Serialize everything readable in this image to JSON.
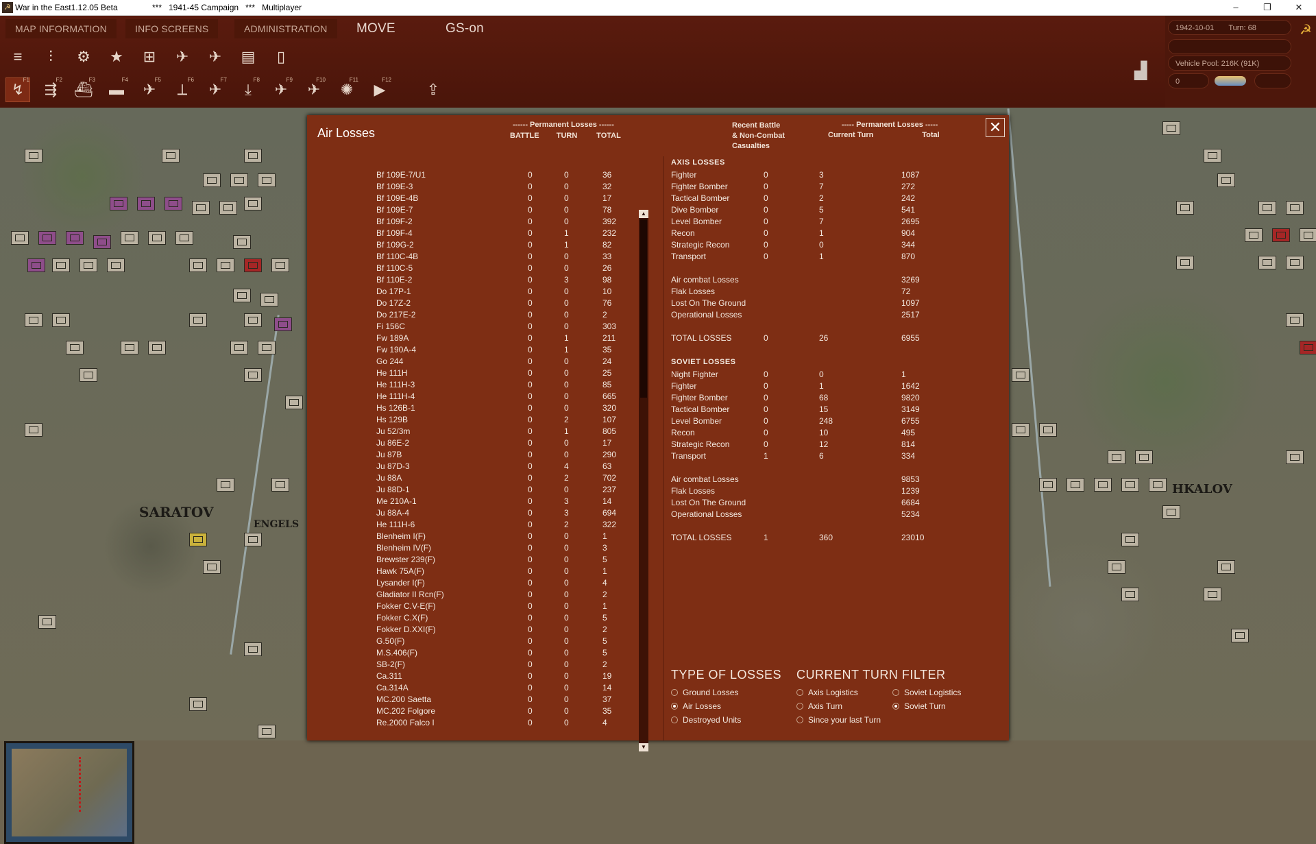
{
  "window": {
    "app_title": "War in the East1.12.05 Beta",
    "campaign": "***   1941-45 Campaign   ***   Multiplayer",
    "minimize": "–",
    "restore": "❐",
    "close": "✕"
  },
  "menu": {
    "tabs": [
      "MAP INFORMATION",
      "INFO SCREENS",
      "ADMINISTRATION",
      "MOVE",
      "GS-on"
    ]
  },
  "status": {
    "date": "1942-10-01",
    "turn": "Turn: 68",
    "vehicle_pool": "Vehicle Pool: 216K (91K)",
    "value": "0"
  },
  "dialog": {
    "title": "Air Losses",
    "left_group_header": "------ Permanent Losses ------",
    "col_battle": "BATTLE",
    "col_turn": "TURN",
    "col_total": "TOTAL",
    "right_recent_header": "Recent Battle\n& Non-Combat\nCasualties",
    "right_perm_header": "----- Permanent Losses -----",
    "right_current": "Current Turn",
    "right_total": "Total",
    "close": "✕"
  },
  "aircraft": [
    {
      "name": "Bf 109E-7/U1",
      "battle": "0",
      "turn": "0",
      "total": "36"
    },
    {
      "name": "Bf 109E-3",
      "battle": "0",
      "turn": "0",
      "total": "32"
    },
    {
      "name": "Bf 109E-4B",
      "battle": "0",
      "turn": "0",
      "total": "17"
    },
    {
      "name": "Bf 109E-7",
      "battle": "0",
      "turn": "0",
      "total": "78"
    },
    {
      "name": "Bf 109F-2",
      "battle": "0",
      "turn": "0",
      "total": "392"
    },
    {
      "name": "Bf 109F-4",
      "battle": "0",
      "turn": "1",
      "total": "232"
    },
    {
      "name": "Bf 109G-2",
      "battle": "0",
      "turn": "1",
      "total": "82"
    },
    {
      "name": "Bf 110C-4B",
      "battle": "0",
      "turn": "0",
      "total": "33"
    },
    {
      "name": "Bf 110C-5",
      "battle": "0",
      "turn": "0",
      "total": "26"
    },
    {
      "name": "Bf 110E-2",
      "battle": "0",
      "turn": "3",
      "total": "98"
    },
    {
      "name": "Do 17P-1",
      "battle": "0",
      "turn": "0",
      "total": "10"
    },
    {
      "name": "Do 17Z-2",
      "battle": "0",
      "turn": "0",
      "total": "76"
    },
    {
      "name": "Do 217E-2",
      "battle": "0",
      "turn": "0",
      "total": "2"
    },
    {
      "name": "Fi 156C",
      "battle": "0",
      "turn": "0",
      "total": "303"
    },
    {
      "name": "Fw 189A",
      "battle": "0",
      "turn": "1",
      "total": "211"
    },
    {
      "name": "Fw 190A-4",
      "battle": "0",
      "turn": "1",
      "total": "35"
    },
    {
      "name": "Go 244",
      "battle": "0",
      "turn": "0",
      "total": "24"
    },
    {
      "name": "He 111H",
      "battle": "0",
      "turn": "0",
      "total": "25"
    },
    {
      "name": "He 111H-3",
      "battle": "0",
      "turn": "0",
      "total": "85"
    },
    {
      "name": "He 111H-4",
      "battle": "0",
      "turn": "0",
      "total": "665"
    },
    {
      "name": "Hs 126B-1",
      "battle": "0",
      "turn": "0",
      "total": "320"
    },
    {
      "name": "Hs 129B",
      "battle": "0",
      "turn": "2",
      "total": "107"
    },
    {
      "name": "Ju 52/3m",
      "battle": "0",
      "turn": "1",
      "total": "805"
    },
    {
      "name": "Ju 86E-2",
      "battle": "0",
      "turn": "0",
      "total": "17"
    },
    {
      "name": "Ju 87B",
      "battle": "0",
      "turn": "0",
      "total": "290"
    },
    {
      "name": "Ju 87D-3",
      "battle": "0",
      "turn": "4",
      "total": "63"
    },
    {
      "name": "Ju 88A",
      "battle": "0",
      "turn": "2",
      "total": "702"
    },
    {
      "name": "Ju 88D-1",
      "battle": "0",
      "turn": "0",
      "total": "237"
    },
    {
      "name": "Me 210A-1",
      "battle": "0",
      "turn": "3",
      "total": "14"
    },
    {
      "name": "Ju 88A-4",
      "battle": "0",
      "turn": "3",
      "total": "694"
    },
    {
      "name": "He 111H-6",
      "battle": "0",
      "turn": "2",
      "total": "322"
    },
    {
      "name": "Blenheim I(F)",
      "battle": "0",
      "turn": "0",
      "total": "1"
    },
    {
      "name": "Blenheim IV(F)",
      "battle": "0",
      "turn": "0",
      "total": "3"
    },
    {
      "name": "Brewster 239(F)",
      "battle": "0",
      "turn": "0",
      "total": "5"
    },
    {
      "name": "Hawk 75A(F)",
      "battle": "0",
      "turn": "0",
      "total": "1"
    },
    {
      "name": "Lysander I(F)",
      "battle": "0",
      "turn": "0",
      "total": "4"
    },
    {
      "name": "Gladiator II Rcn(F)",
      "battle": "0",
      "turn": "0",
      "total": "2"
    },
    {
      "name": "Fokker C.V-E(F)",
      "battle": "0",
      "turn": "0",
      "total": "1"
    },
    {
      "name": "Fokker C.X(F)",
      "battle": "0",
      "turn": "0",
      "total": "5"
    },
    {
      "name": "Fokker D.XXI(F)",
      "battle": "0",
      "turn": "0",
      "total": "2"
    },
    {
      "name": "G.50(F)",
      "battle": "0",
      "turn": "0",
      "total": "5"
    },
    {
      "name": "M.S.406(F)",
      "battle": "0",
      "turn": "0",
      "total": "5"
    },
    {
      "name": "SB-2(F)",
      "battle": "0",
      "turn": "0",
      "total": "2"
    },
    {
      "name": "Ca.311",
      "battle": "0",
      "turn": "0",
      "total": "19"
    },
    {
      "name": "Ca.314A",
      "battle": "0",
      "turn": "0",
      "total": "14"
    },
    {
      "name": "MC.200 Saetta",
      "battle": "0",
      "turn": "0",
      "total": "37"
    },
    {
      "name": "MC.202 Folgore",
      "battle": "0",
      "turn": "0",
      "total": "35"
    },
    {
      "name": "Re.2000 Falco I",
      "battle": "0",
      "turn": "0",
      "total": "4"
    }
  ],
  "axis": {
    "header": "AXIS LOSSES",
    "rows": [
      {
        "label": "Fighter",
        "recent": "0",
        "current": "3",
        "total": "1087"
      },
      {
        "label": "Fighter Bomber",
        "recent": "0",
        "current": "7",
        "total": "272"
      },
      {
        "label": "Tactical Bomber",
        "recent": "0",
        "current": "2",
        "total": "242"
      },
      {
        "label": "Dive Bomber",
        "recent": "0",
        "current": "5",
        "total": "541"
      },
      {
        "label": "Level Bomber",
        "recent": "0",
        "current": "7",
        "total": "2695"
      },
      {
        "label": "Recon",
        "recent": "0",
        "current": "1",
        "total": "904"
      },
      {
        "label": "Strategic Recon",
        "recent": "0",
        "current": "0",
        "total": "344"
      },
      {
        "label": "Transport",
        "recent": "0",
        "current": "1",
        "total": "870"
      }
    ],
    "summary": [
      {
        "label": "Air combat Losses",
        "total": "3269"
      },
      {
        "label": "Flak Losses",
        "total": "72"
      },
      {
        "label": "Lost On The Ground",
        "total": "1097"
      },
      {
        "label": "Operational Losses",
        "total": "2517"
      }
    ],
    "total": {
      "label": "TOTAL LOSSES",
      "recent": "0",
      "current": "26",
      "total": "6955"
    }
  },
  "soviet": {
    "header": "SOVIET LOSSES",
    "rows": [
      {
        "label": "Night Fighter",
        "recent": "0",
        "current": "0",
        "total": "1"
      },
      {
        "label": "Fighter",
        "recent": "0",
        "current": "1",
        "total": "1642"
      },
      {
        "label": "Fighter Bomber",
        "recent": "0",
        "current": "68",
        "total": "9820"
      },
      {
        "label": "Tactical Bomber",
        "recent": "0",
        "current": "15",
        "total": "3149"
      },
      {
        "label": "Level Bomber",
        "recent": "0",
        "current": "248",
        "total": "6755"
      },
      {
        "label": "Recon",
        "recent": "0",
        "current": "10",
        "total": "495"
      },
      {
        "label": "Strategic Recon",
        "recent": "0",
        "current": "12",
        "total": "814"
      },
      {
        "label": "Transport",
        "recent": "1",
        "current": "6",
        "total": "334"
      }
    ],
    "summary": [
      {
        "label": "Air combat Losses",
        "total": "9853"
      },
      {
        "label": "Flak Losses",
        "total": "1239"
      },
      {
        "label": "Lost On The Ground",
        "total": "6684"
      },
      {
        "label": "Operational Losses",
        "total": "5234"
      }
    ],
    "total": {
      "label": "TOTAL LOSSES",
      "recent": "1",
      "current": "360",
      "total": "23010"
    }
  },
  "type_of_losses": {
    "title": "TYPE OF LOSSES",
    "options": [
      {
        "label": "Ground Losses",
        "selected": false
      },
      {
        "label": "Air Losses",
        "selected": true
      },
      {
        "label": "Destroyed Units",
        "selected": false
      }
    ]
  },
  "turn_filter": {
    "title": "CURRENT TURN FILTER",
    "options": [
      {
        "label": "Axis Logistics",
        "selected": false
      },
      {
        "label": "Soviet Logistics",
        "selected": false
      },
      {
        "label": "Axis Turn",
        "selected": false
      },
      {
        "label": "Soviet Turn",
        "selected": true
      },
      {
        "label": "Since your last Turn",
        "selected": false
      }
    ]
  },
  "map": {
    "city_saratov": "SARATOV",
    "city_engels": "ENGELS",
    "city_chkalov": "HKALOV"
  }
}
